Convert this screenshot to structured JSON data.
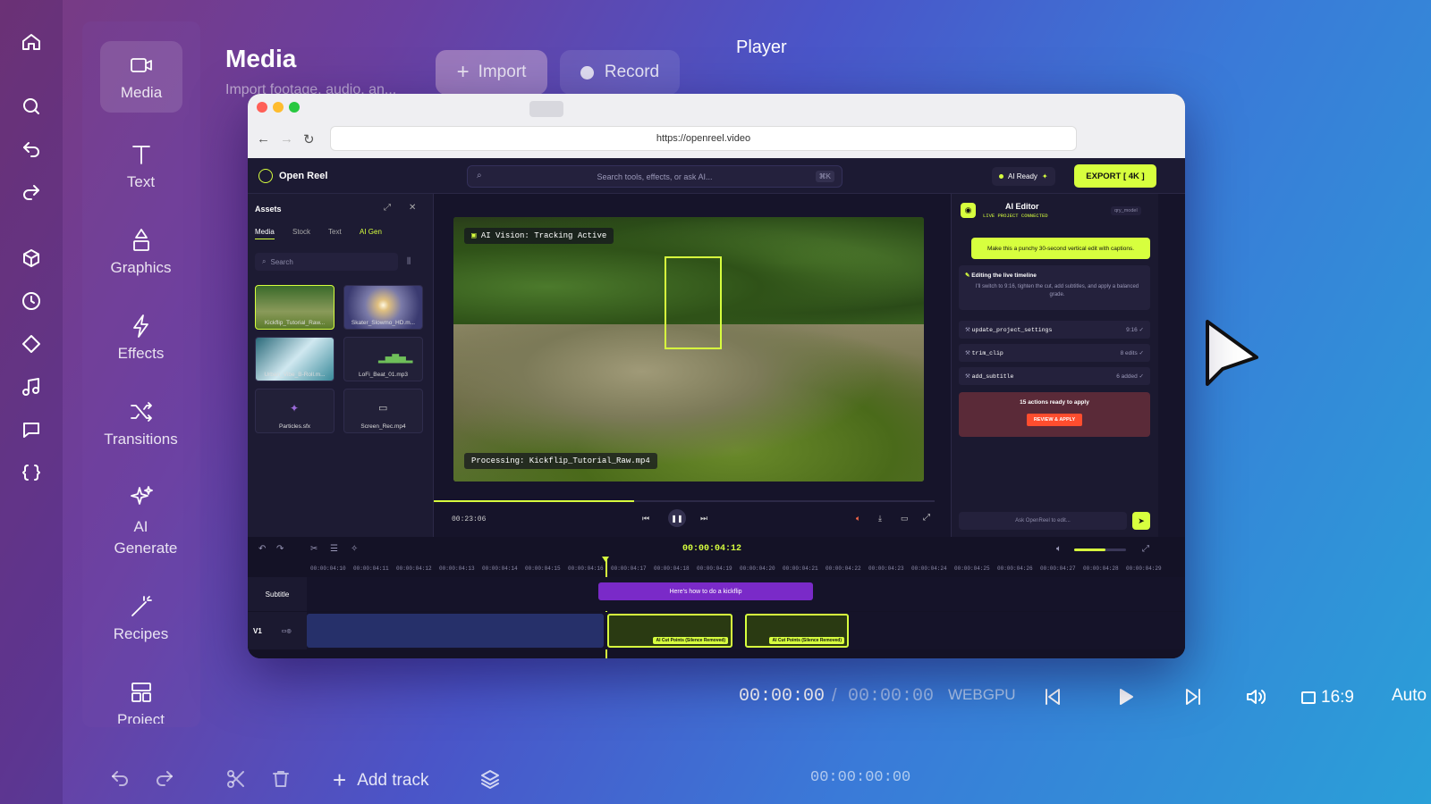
{
  "rail": {
    "icons": [
      "home-icon",
      "search-icon",
      "undo-icon",
      "redo-icon",
      "cube-icon",
      "clock-icon",
      "diamond-icon",
      "music-icon",
      "chat-icon",
      "code-braces-icon"
    ]
  },
  "sidebar": {
    "items": [
      {
        "label": "Media",
        "icon": "video-camera-icon"
      },
      {
        "label": "Text",
        "icon": "text-icon"
      },
      {
        "label": "Graphics",
        "icon": "shapes-icon"
      },
      {
        "label": "Effects",
        "icon": "lightning-icon"
      },
      {
        "label": "Transitions",
        "icon": "shuffle-icon"
      },
      {
        "label": "AI Generate",
        "icon": "sparkle-icon"
      },
      {
        "label": "Recipes",
        "icon": "magic-wand-icon"
      },
      {
        "label": "Project",
        "icon": "layout-icon"
      }
    ]
  },
  "media": {
    "title": "Media",
    "subtitle": "Import footage, audio, an...",
    "import_label": "Import",
    "record_label": "Record"
  },
  "player": {
    "title": "Player",
    "current_time": "00:00:00",
    "separator": "/",
    "total_time": "00:00:00",
    "renderer": "WEBGPU",
    "aspect": "16:9",
    "quality": "Auto"
  },
  "bottom": {
    "add_track": "Add track",
    "timecode": "00:00:00:00"
  },
  "browser": {
    "url": "https://openreel.video"
  },
  "app": {
    "name": "Open Reel",
    "search_placeholder": "Search tools, effects, or ask AI...",
    "search_shortcut": "⌘K",
    "ai_status": "AI Ready",
    "export_label": "EXPORT [ 4K ]",
    "assets": {
      "title": "Assets",
      "tabs": [
        "Media",
        "Stock",
        "Text",
        "AI Gen"
      ],
      "search_placeholder": "Search",
      "files": [
        "Kickflip_Tutorial_Raw...",
        "Skater_Slowmo_HD.m...",
        "Urban_Vibe_B-Roll.m...",
        "LoFi_Beat_01.mp3",
        "Particles.sfx",
        "Screen_Rec.mp4"
      ]
    },
    "preview": {
      "tracking_label": "AI Vision: Tracking Active",
      "processing_label": "Processing: Kickflip_Tutorial_Raw.mp4",
      "time": "00:23:06"
    },
    "ai_editor": {
      "title": "AI Editor",
      "status": "LIVE PROJECT CONNECTED",
      "model_badge": "qry_model",
      "prompt": "Make this a punchy 30-second vertical edit with captions.",
      "working_title": "Editing the live timeline",
      "working_body": "I'll switch to 9:16, tighten the cut, add subtitles, and apply a balanced grade.",
      "actions": [
        {
          "name": "update_project_settings",
          "meta": "9:16"
        },
        {
          "name": "trim_clip",
          "meta": "8 edits"
        },
        {
          "name": "add_subtitle",
          "meta": "6 added"
        }
      ],
      "ready_text": "15 actions ready to apply",
      "review_label": "REVIEW & APPLY",
      "input_placeholder": "Ask OpenReel to edit..."
    },
    "timeline": {
      "timecode": "00:00:04:12",
      "ruler": [
        "00:00:04:10",
        "00:00:04:11",
        "00:00:04:12",
        "00:00:04:13",
        "00:00:04:14",
        "00:00:04:15",
        "00:00:04:16",
        "00:00:04:17",
        "00:00:04:18",
        "00:00:04:19",
        "00:00:04:20",
        "00:00:04:21",
        "00:00:04:22",
        "00:00:04:23",
        "00:00:04:24",
        "00:00:04:25",
        "00:00:04:26",
        "00:00:04:27",
        "00:00:04:28",
        "00:00:04:29"
      ],
      "tracks": [
        {
          "label": "Subtitle"
        },
        {
          "label": "V1"
        }
      ],
      "subtitle_clip": "Here's how to do a kickflip",
      "video_clips": [
        "AI Cut Points (Silence Removed)",
        "AI Cut Points (Silence Removed)"
      ]
    }
  },
  "colors": {
    "accent": "#d7ff3e",
    "record_red": "#ff4d2e",
    "panel": "#1b1930"
  }
}
